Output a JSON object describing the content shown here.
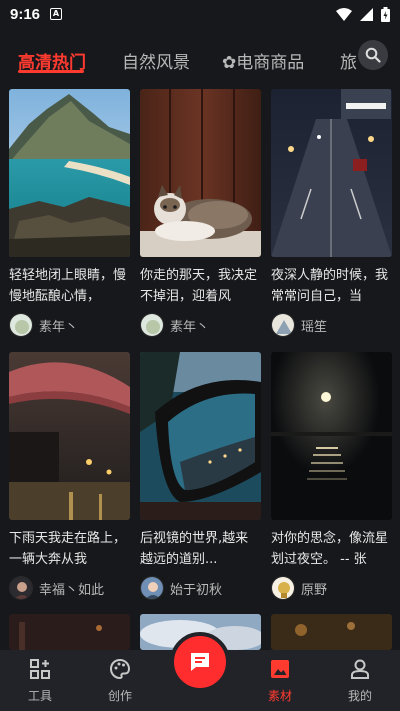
{
  "status_bar": {
    "time": "9:16",
    "notification_glyph": "A"
  },
  "tabs": [
    {
      "label": "高清热门",
      "active": true
    },
    {
      "label": "自然风景",
      "active": false
    },
    {
      "label": "✿电商商品",
      "active": false
    },
    {
      "label": "旅",
      "active": false
    }
  ],
  "cards": [
    {
      "caption": "轻轻地闭上眼睛，慢慢地酝酿心情，",
      "author": "素年丶"
    },
    {
      "caption": "你走的那天，我决定不掉泪，迎着风",
      "author": "素年丶"
    },
    {
      "caption": "夜深人静的时候，我常常问自己，当",
      "author": "瑶笙"
    },
    {
      "caption": "下雨天我走在路上，一辆大奔从我",
      "author": "幸福丶如此"
    },
    {
      "caption": "后视镜的世界,越来越远的道别...",
      "author": "始于初秋"
    },
    {
      "caption": "对你的思念，像流星划过夜空。 -- 张",
      "author": "原野"
    }
  ],
  "bottom_nav": [
    {
      "label": "工具",
      "icon": "grid-plus-icon",
      "active": false
    },
    {
      "label": "创作",
      "icon": "palette-icon",
      "active": false
    },
    {
      "label": "素材",
      "icon": "image-icon",
      "active": true
    },
    {
      "label": "我的",
      "icon": "person-icon",
      "active": false
    }
  ],
  "fab": {
    "icon": "message-icon"
  },
  "colors": {
    "accent": "#ff3b30",
    "background": "#17181c",
    "nav_background": "#222328"
  }
}
